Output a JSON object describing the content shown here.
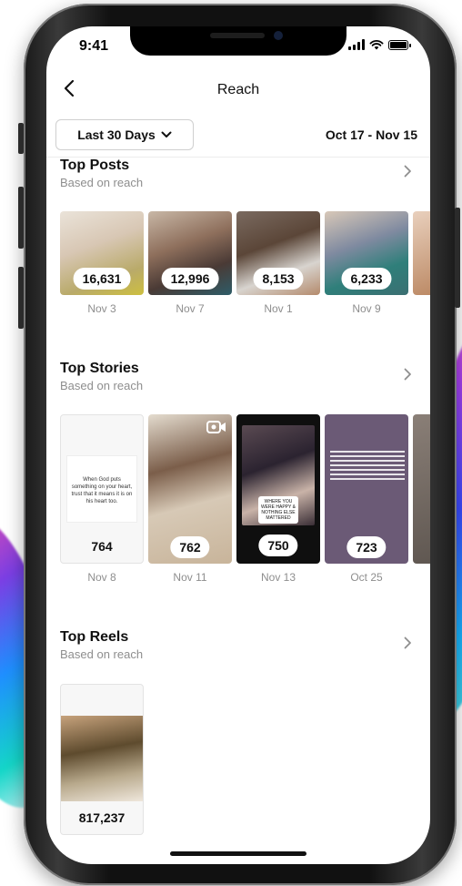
{
  "status_bar": {
    "time": "9:41"
  },
  "header": {
    "title": "Reach"
  },
  "filter": {
    "range_label": "Last 30 Days",
    "dates": "Oct 17 - Nov 15"
  },
  "top_posts": {
    "title": "Top Posts",
    "subtitle": "Based on reach",
    "items": [
      {
        "value": "16,631",
        "date": "Nov 3"
      },
      {
        "value": "12,996",
        "date": "Nov 7"
      },
      {
        "value": "8,153",
        "date": "Nov 1"
      },
      {
        "value": "6,233",
        "date": "Nov 9"
      }
    ]
  },
  "top_stories": {
    "title": "Top Stories",
    "subtitle": "Based on reach",
    "items": [
      {
        "value": "764",
        "date": "Nov 8",
        "text": "When God puts something on your heart, trust that it means it is on his heart too."
      },
      {
        "value": "762",
        "date": "Nov 11"
      },
      {
        "value": "750",
        "date": "Nov 13",
        "text": "WHERE YOU WERE HAPPY & NOTHING ELSE MATTERED"
      },
      {
        "value": "723",
        "date": "Oct 25"
      }
    ]
  },
  "top_reels": {
    "title": "Top Reels",
    "subtitle": "Based on reach",
    "items": [
      {
        "value": "817,237"
      }
    ]
  },
  "icons": {
    "back": "chevron-left-icon",
    "dropdown": "chevron-down-icon",
    "section_arrow": "chevron-right-icon",
    "video": "video-icon"
  },
  "colors": {
    "background": "#ffffff",
    "muted_text": "#8e8e8e",
    "pill": "#ffffff",
    "text": "#111111"
  }
}
